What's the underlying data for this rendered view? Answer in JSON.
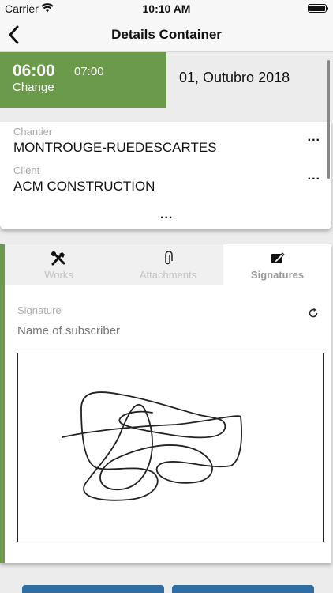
{
  "status_bar": {
    "carrier": "Carrier",
    "time": "10:10 AM"
  },
  "nav": {
    "title": "Details Container"
  },
  "time_block": {
    "start": "06:00",
    "end": "07:00",
    "change_label": "Change"
  },
  "date": "01, Outubro 2018",
  "info": {
    "chantier_label": "Chantier",
    "chantier_value": "MONTROUGE-RUEDESCARTES",
    "client_label": "Client",
    "client_value": "ACM CONSTRUCTION",
    "more": "..."
  },
  "tabs": [
    {
      "label": "Works",
      "icon": "tools-icon"
    },
    {
      "label": "Attachments",
      "icon": "paperclip-icon"
    },
    {
      "label": "Signatures",
      "icon": "pen-square-icon"
    }
  ],
  "signature": {
    "label": "Signature",
    "subscriber_placeholder": "Name of subscriber"
  },
  "colors": {
    "accent": "#6a9a4a",
    "button": "#2e6ea2"
  }
}
